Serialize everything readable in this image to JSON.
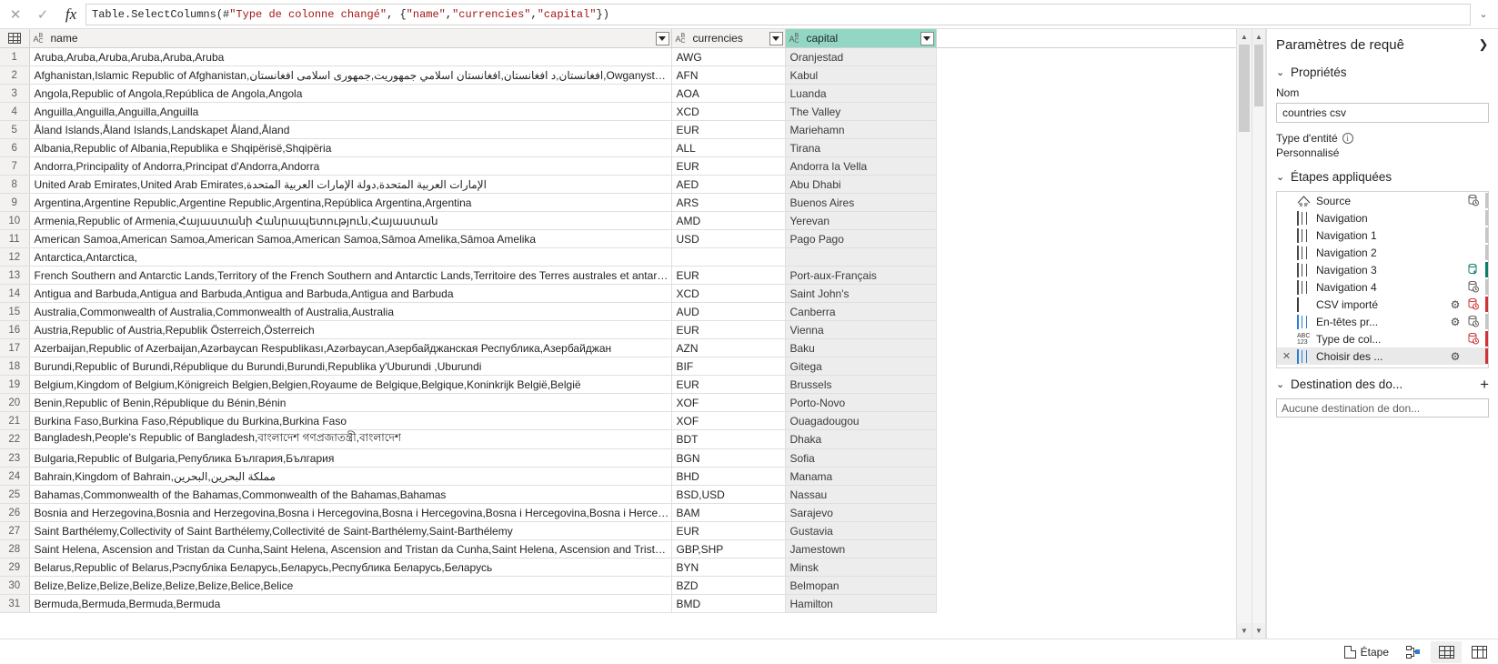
{
  "formula_bar": {
    "cancel_icon": "close-icon",
    "accept_icon": "check-icon",
    "fx_label": "fx",
    "formula_prefix": "Table.SelectColumns(#",
    "formula_arg1": "\"Type de colonne changé\"",
    "formula_mid": ", {",
    "formula_col1": "\"name\"",
    "formula_sep1": ", ",
    "formula_col2": "\"currencies\"",
    "formula_sep2": ", ",
    "formula_col3": "\"capital\"",
    "formula_suffix": "})",
    "expand_icon": "chevron-down-icon"
  },
  "grid": {
    "columns": [
      {
        "label": "name",
        "type_icon": "abc-text-type-icon",
        "selected": false
      },
      {
        "label": "currencies",
        "type_icon": "abc-text-type-icon",
        "selected": false
      },
      {
        "label": "capital",
        "type_icon": "abc-text-type-icon",
        "selected": true
      }
    ],
    "rows": [
      {
        "n": "1",
        "name": "Aruba,Aruba,Aruba,Aruba,Aruba,Aruba",
        "currencies": "AWG",
        "capital": "Oranjestad"
      },
      {
        "n": "2",
        "name": "Afghanistan,Islamic Republic of Afghanistan,افغانستان,د افغانستان,افغانستان اسلامي جمهوريت,جمهوری اسلامی افغانستان,Owganystan Yslam Respublikasy…",
        "currencies": "AFN",
        "capital": "Kabul"
      },
      {
        "n": "3",
        "name": "Angola,Republic of Angola,República de Angola,Angola",
        "currencies": "AOA",
        "capital": "Luanda"
      },
      {
        "n": "4",
        "name": "Anguilla,Anguilla,Anguilla,Anguilla",
        "currencies": "XCD",
        "capital": "The Valley"
      },
      {
        "n": "5",
        "name": "Åland Islands,Åland Islands,Landskapet Åland,Åland",
        "currencies": "EUR",
        "capital": "Mariehamn"
      },
      {
        "n": "6",
        "name": "Albania,Republic of Albania,Republika e Shqipërisë,Shqipëria",
        "currencies": "ALL",
        "capital": "Tirana"
      },
      {
        "n": "7",
        "name": "Andorra,Principality of Andorra,Principat d'Andorra,Andorra",
        "currencies": "EUR",
        "capital": "Andorra la Vella"
      },
      {
        "n": "8",
        "name": "United Arab Emirates,United Arab Emirates,الإمارات العربية المتحدة,دولة الإمارات العربية المتحدة",
        "currencies": "AED",
        "capital": "Abu Dhabi"
      },
      {
        "n": "9",
        "name": "Argentina,Argentine Republic,Argentine Republic,Argentina,República Argentina,Argentina",
        "currencies": "ARS",
        "capital": "Buenos Aires"
      },
      {
        "n": "10",
        "name": "Armenia,Republic of Armenia,Հայաստանի Հանրապետություն,Հայաստան",
        "currencies": "AMD",
        "capital": "Yerevan"
      },
      {
        "n": "11",
        "name": "American Samoa,American Samoa,American Samoa,American Samoa,Sāmoa Amelika,Sāmoa Amelika",
        "currencies": "USD",
        "capital": "Pago Pago"
      },
      {
        "n": "12",
        "name": "Antarctica,Antarctica,",
        "currencies": "",
        "capital": ""
      },
      {
        "n": "13",
        "name": "French Southern and Antarctic Lands,Territory of the French Southern and Antarctic Lands,Territoire des Terres australes et antarctiques françaises,Terr…",
        "currencies": "EUR",
        "capital": "Port-aux-Français"
      },
      {
        "n": "14",
        "name": "Antigua and Barbuda,Antigua and Barbuda,Antigua and Barbuda,Antigua and Barbuda",
        "currencies": "XCD",
        "capital": "Saint John's"
      },
      {
        "n": "15",
        "name": "Australia,Commonwealth of Australia,Commonwealth of Australia,Australia",
        "currencies": "AUD",
        "capital": "Canberra"
      },
      {
        "n": "16",
        "name": "Austria,Republic of Austria,Republik Österreich,Österreich",
        "currencies": "EUR",
        "capital": "Vienna"
      },
      {
        "n": "17",
        "name": "Azerbaijan,Republic of Azerbaijan,Azərbaycan Respublikası,Azərbaycan,Азербайджанская Республика,Азербайджан",
        "currencies": "AZN",
        "capital": "Baku"
      },
      {
        "n": "18",
        "name": "Burundi,Republic of Burundi,République du Burundi,Burundi,Republika y'Uburundi ,Uburundi",
        "currencies": "BIF",
        "capital": "Gitega"
      },
      {
        "n": "19",
        "name": "Belgium,Kingdom of Belgium,Königreich Belgien,Belgien,Royaume de Belgique,Belgique,Koninkrijk België,België",
        "currencies": "EUR",
        "capital": "Brussels"
      },
      {
        "n": "20",
        "name": "Benin,Republic of Benin,République du Bénin,Bénin",
        "currencies": "XOF",
        "capital": "Porto-Novo"
      },
      {
        "n": "21",
        "name": "Burkina Faso,Burkina Faso,République du Burkina,Burkina Faso",
        "currencies": "XOF",
        "capital": "Ouagadougou"
      },
      {
        "n": "22",
        "name": "Bangladesh,People's Republic of Bangladesh,বাংলাদেশ গণপ্রজাতন্ত্রী,বাংলাদেশ",
        "currencies": "BDT",
        "capital": "Dhaka"
      },
      {
        "n": "23",
        "name": "Bulgaria,Republic of Bulgaria,Република България,България",
        "currencies": "BGN",
        "capital": "Sofia"
      },
      {
        "n": "24",
        "name": "Bahrain,Kingdom of Bahrain,مملكة البحرين,البحرين",
        "currencies": "BHD",
        "capital": "Manama"
      },
      {
        "n": "25",
        "name": "Bahamas,Commonwealth of the Bahamas,Commonwealth of the Bahamas,Bahamas",
        "currencies": "BSD,USD",
        "capital": "Nassau"
      },
      {
        "n": "26",
        "name": "Bosnia and Herzegovina,Bosnia and Herzegovina,Bosna i Hercegovina,Bosna i Hercegovina,Bosna i Hercegovina,Bosna i Hercegovina,Босна и Херцег…",
        "currencies": "BAM",
        "capital": "Sarajevo"
      },
      {
        "n": "27",
        "name": "Saint Barthélemy,Collectivity of Saint Barthélemy,Collectivité de Saint-Barthélemy,Saint-Barthélemy",
        "currencies": "EUR",
        "capital": "Gustavia"
      },
      {
        "n": "28",
        "name": "Saint Helena, Ascension and Tristan da Cunha,Saint Helena, Ascension and Tristan da Cunha,Saint Helena, Ascension and Tristan da Cunha,Saint Helen…",
        "currencies": "GBP,SHP",
        "capital": "Jamestown"
      },
      {
        "n": "29",
        "name": "Belarus,Republic of Belarus,Рэспубліка Беларусь,Беларусь,Республика Беларусь,Беларусь",
        "currencies": "BYN",
        "capital": "Minsk"
      },
      {
        "n": "30",
        "name": "Belize,Belize,Belize,Belize,Belize,Belize,Belice,Belice",
        "currencies": "BZD",
        "capital": "Belmopan"
      },
      {
        "n": "31",
        "name": "Bermuda,Bermuda,Bermuda,Bermuda",
        "currencies": "BMD",
        "capital": "Hamilton"
      }
    ]
  },
  "right_pane": {
    "title": "Paramètres de requê",
    "collapse_icon": "chevron-right-icon",
    "properties": {
      "section_title": "Propriétés",
      "name_label": "Nom",
      "name_value": "countries csv",
      "entity_type_label": "Type d'entité",
      "entity_type_value": "Personnalisé"
    },
    "applied_steps": {
      "section_title": "Étapes appliquées",
      "steps": [
        {
          "label": "Source",
          "icon": "source-icon",
          "gear": false,
          "right_icon": "db-clock-icon",
          "right_color": "#605e5c",
          "bar": "#c8c6c4",
          "selected": false,
          "has_x": false
        },
        {
          "label": "Navigation",
          "icon": "table-icon",
          "gear": false,
          "right_icon": "",
          "right_color": "",
          "bar": "#c8c6c4",
          "selected": false,
          "has_x": false
        },
        {
          "label": "Navigation 1",
          "icon": "table-icon",
          "gear": false,
          "right_icon": "",
          "right_color": "",
          "bar": "#c8c6c4",
          "selected": false,
          "has_x": false
        },
        {
          "label": "Navigation 2",
          "icon": "table-icon",
          "gear": false,
          "right_icon": "",
          "right_color": "",
          "bar": "#c8c6c4",
          "selected": false,
          "has_x": false
        },
        {
          "label": "Navigation 3",
          "icon": "table-icon",
          "gear": false,
          "right_icon": "db-bolt-icon",
          "right_color": "#0f7c6c",
          "bar": "#0f7c6c",
          "selected": false,
          "has_x": false
        },
        {
          "label": "Navigation 4",
          "icon": "table-icon",
          "gear": false,
          "right_icon": "db-clock-icon",
          "right_color": "#605e5c",
          "bar": "#c8c6c4",
          "selected": false,
          "has_x": false
        },
        {
          "label": "CSV importé",
          "icon": "csv-file-icon",
          "gear": true,
          "right_icon": "db-clock-icon",
          "right_color": "#d13438",
          "bar": "#d13438",
          "selected": false,
          "has_x": false
        },
        {
          "label": "En-têtes pr...",
          "icon": "table-blue-icon",
          "gear": true,
          "right_icon": "db-clock-icon",
          "right_color": "#605e5c",
          "bar": "#c8c6c4",
          "selected": false,
          "has_x": false
        },
        {
          "label": "Type de col...",
          "icon": "abc123-icon",
          "gear": false,
          "right_icon": "db-clock-icon",
          "right_color": "#d13438",
          "bar": "#d13438",
          "selected": false,
          "has_x": false
        },
        {
          "label": "Choisir des ...",
          "icon": "table-blue-icon",
          "gear": true,
          "right_icon": "",
          "right_color": "",
          "bar": "#d13438",
          "selected": true,
          "has_x": true
        }
      ]
    },
    "data_destination": {
      "section_title": "Destination des do...",
      "add_icon": "plus-icon",
      "value": "Aucune destination de don..."
    }
  },
  "status_bar": {
    "step_label": "Étape",
    "step_icon": "step-page-icon",
    "diagram_icon": "diagram-view-icon",
    "grid_view_icon": "data-view-icon",
    "column_view_icon": "column-view-icon"
  },
  "colors": {
    "selected_header": "#92d6c4",
    "selected_cell": "#ededed",
    "header_bg": "#f3f2f1",
    "accent_blue": "#2b7cd3",
    "error_red": "#d13438",
    "teal": "#0f7c6c"
  }
}
